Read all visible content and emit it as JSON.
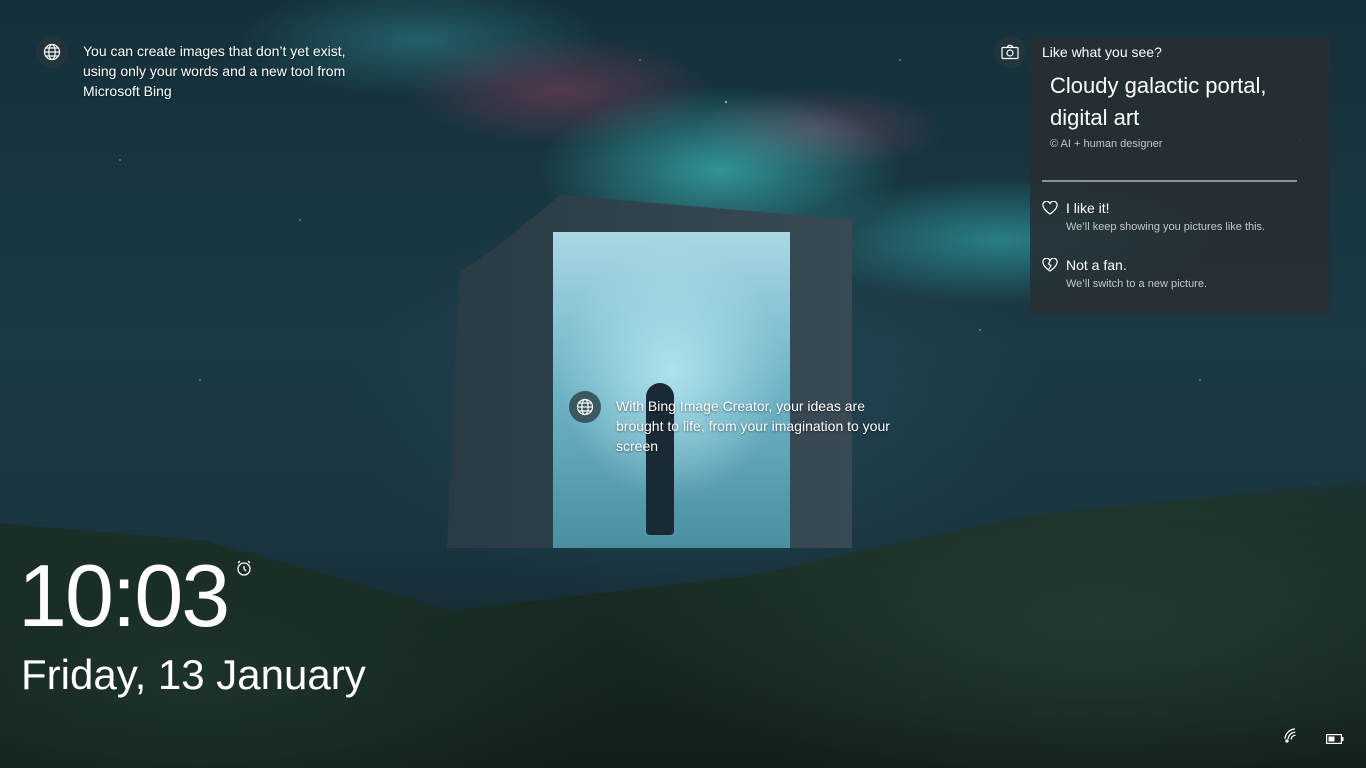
{
  "info_top": {
    "text": "You can create images that don’t yet exist, using only your words and a new tool from Microsoft Bing",
    "icon": "globe-icon"
  },
  "info_center": {
    "text": "With Bing Image Creator, your ideas are brought to life, from your imagination to your screen",
    "icon": "globe-icon"
  },
  "spotlight": {
    "camera_icon": "camera-icon",
    "heading": "Like what you see?",
    "title": "Cloudy galactic portal, digital art",
    "credit": "© AI + human designer",
    "like": {
      "label": "I like it!",
      "sub": "We’ll keep showing you pictures like this.",
      "icon": "heart-icon"
    },
    "dislike": {
      "label": "Not a fan.",
      "sub": "We’ll switch to a new picture.",
      "icon": "broken-heart-icon"
    }
  },
  "clock": {
    "time": "10:03",
    "date": "Friday, 13 January",
    "alarm_icon": "alarm-clock-icon"
  },
  "tray": {
    "network_icon": "wifi-icon",
    "battery_icon": "battery-icon"
  },
  "colors": {
    "card_bg": "#262e32",
    "text": "#ffffff",
    "subtext": "#c3c8ca"
  }
}
